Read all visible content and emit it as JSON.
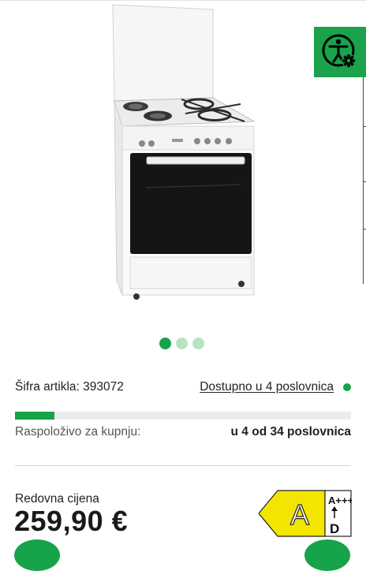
{
  "accessibility": {
    "icon": "accessibility-gear-icon",
    "color": "#1aa34a"
  },
  "gallery": {
    "slides": 3,
    "active_slide": 1
  },
  "product": {
    "sku_text": "Šifra artikla: 393072",
    "availability_link": "Dostupno u 4 poslovnica",
    "stock_fraction": 0.118,
    "stock_label": "Raspoloživo za kupnju:",
    "stock_value": "u 4 od 34 poslovnica",
    "price_label": "Redovna cijena",
    "price": "259,90 €"
  },
  "energy": {
    "class": "A",
    "scale_top": "A+++",
    "scale_bottom": "D",
    "color": "#f2e600"
  },
  "colors": {
    "accent": "#16a34a",
    "accent_light": "#b9e2c5"
  }
}
